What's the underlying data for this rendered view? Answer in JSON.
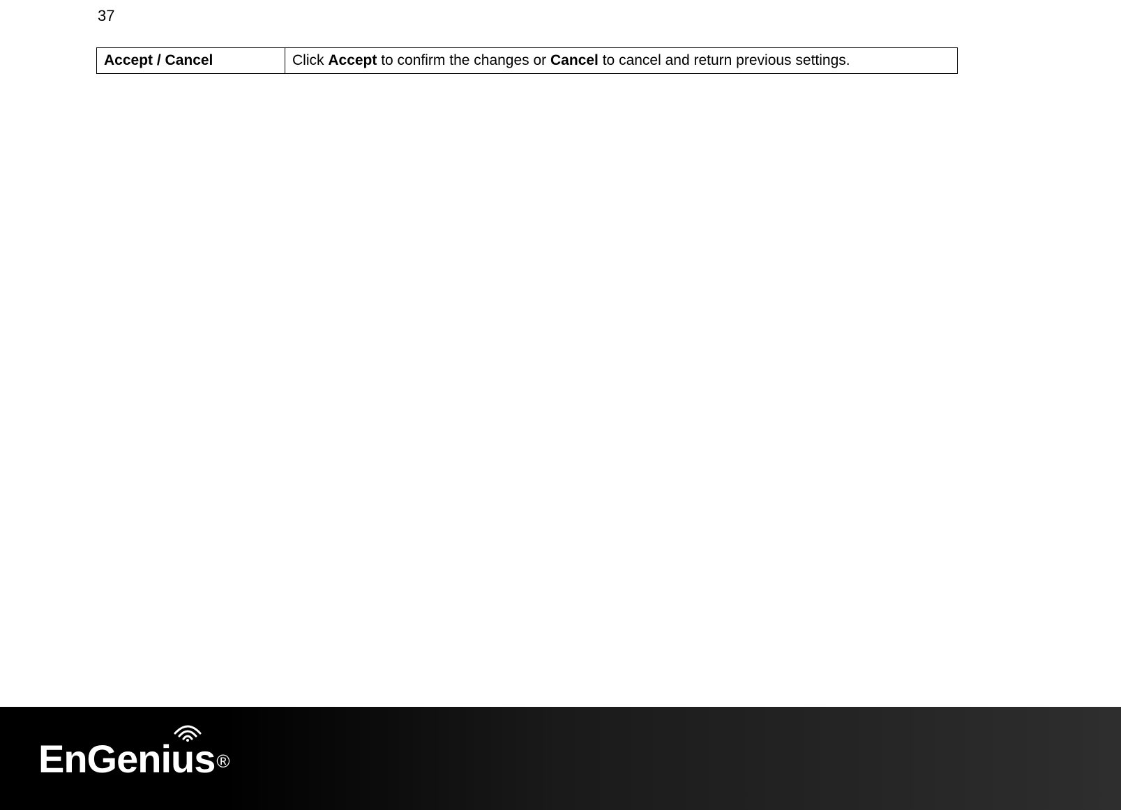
{
  "page_number": "37",
  "table": {
    "row": {
      "label": "Accept / Cancel",
      "desc_prefix": "Click ",
      "desc_bold1": "Accept",
      "desc_mid": " to confirm the changes or ",
      "desc_bold2": "Cancel",
      "desc_suffix": " to cancel and return previous settings."
    }
  },
  "footer": {
    "brand": "EnGenius",
    "registered": "®"
  }
}
